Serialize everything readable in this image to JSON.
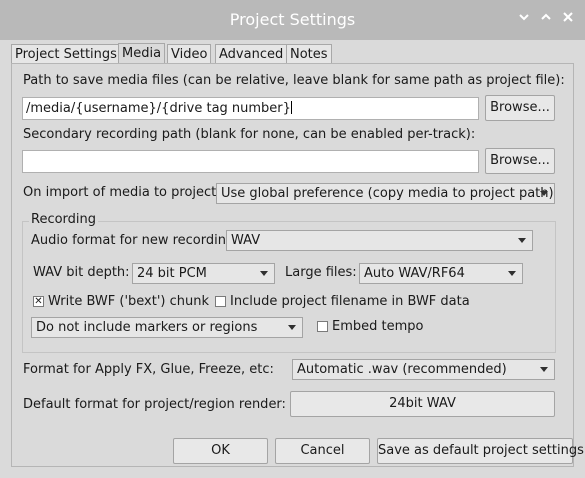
{
  "window": {
    "title": "Project Settings",
    "controls": [
      "chevron-down-icon",
      "chevron-up-icon",
      "close-icon"
    ]
  },
  "tabs": [
    {
      "label": "Project Settings",
      "active": false
    },
    {
      "label": "Media",
      "active": true
    },
    {
      "label": "Video",
      "active": false
    },
    {
      "label": "Advanced",
      "active": false
    },
    {
      "label": "Notes",
      "active": false
    }
  ],
  "media": {
    "path_label": "Path to save media files (can be relative, leave blank for same path as project file):",
    "path_value": "/media/{username}/{drive tag number}",
    "browse_label": "Browse...",
    "secondary_label": "Secondary recording path (blank for none, can be enabled per-track):",
    "secondary_value": "",
    "browse2_label": "Browse...",
    "import_label": "On import of media to project:",
    "import_value": "Use global preference (copy media to project path)"
  },
  "recording": {
    "legend": "Recording",
    "audio_format_label": "Audio format for new recordings:",
    "audio_format_value": "WAV",
    "bit_depth_label": "WAV bit depth:",
    "bit_depth_value": "24 bit PCM",
    "large_files_label": "Large files:",
    "large_files_value": "Auto WAV/RF64",
    "bwf_label": "Write BWF ('bext') chunk",
    "bwf_checked": true,
    "include_filename_label": "Include project filename in BWF data",
    "include_filename_checked": false,
    "markers_value": "Do not include markers or regions",
    "embed_tempo_label": "Embed tempo",
    "embed_tempo_checked": false
  },
  "formats": {
    "apply_fx_label": "Format for Apply FX, Glue, Freeze, etc:",
    "apply_fx_value": "Automatic .wav (recommended)",
    "render_label": "Default format for project/region render:",
    "render_value": "24bit WAV"
  },
  "footer": {
    "ok_label": "OK",
    "cancel_label": "Cancel",
    "save_default_label": "Save as default project settings"
  },
  "colors": {
    "titlebar": "#b9b9b9",
    "background": "#dadada"
  }
}
